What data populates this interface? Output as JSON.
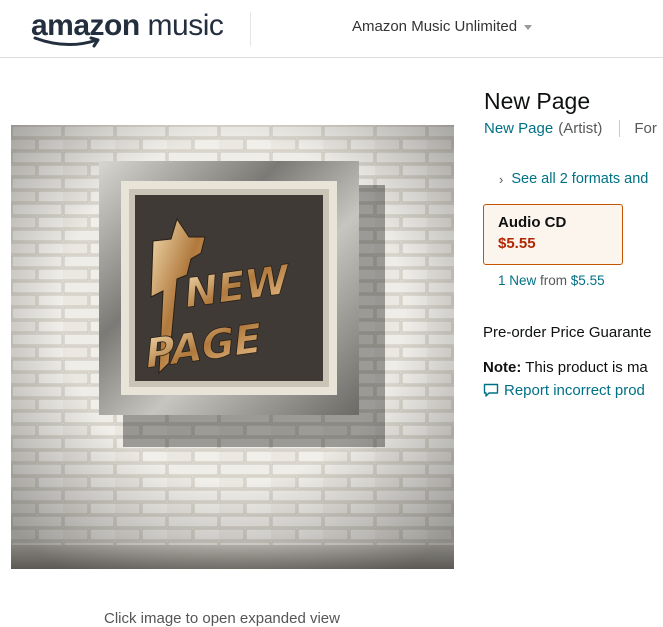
{
  "header": {
    "logo_prefix": "amazon",
    "logo_suffix": "music",
    "store_menu_label": "Amazon Music Unlimited"
  },
  "image_panel": {
    "caption": "Click image to open expanded view",
    "album_art_text": [
      "NEW",
      "PAGE"
    ]
  },
  "product": {
    "title": "New Page",
    "artist_name": "New Page",
    "artist_role": "(Artist)",
    "byline_extra": "For",
    "see_all_label": "See all 2 formats and",
    "format": {
      "name": "Audio CD",
      "price": "$5.55"
    },
    "offers": {
      "new_link": "1 New",
      "from_text": "from",
      "price": "$5.55"
    },
    "preorder_text": "Pre-order Price Guarante",
    "note_label": "Note:",
    "note_text": "This product is ma",
    "report_label": "Report incorrect prod"
  }
}
